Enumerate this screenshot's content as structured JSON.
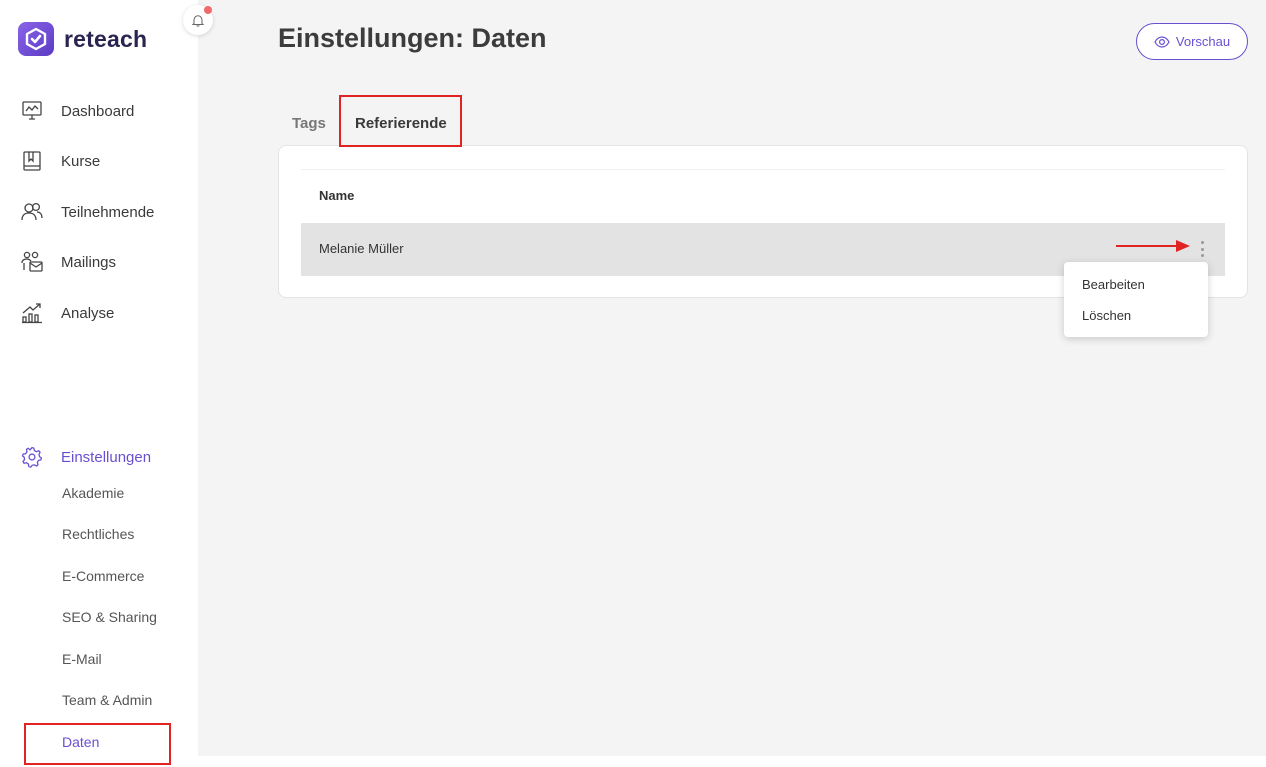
{
  "app": {
    "name": "reteach"
  },
  "sidebar": {
    "nav": [
      {
        "label": "Dashboard",
        "icon": "dashboard-monitor-icon"
      },
      {
        "label": "Kurse",
        "icon": "book-icon"
      },
      {
        "label": "Teilnehmende",
        "icon": "users-icon"
      },
      {
        "label": "Mailings",
        "icon": "mailing-users-icon"
      },
      {
        "label": "Analyse",
        "icon": "analytics-chart-icon"
      }
    ],
    "settings": {
      "label": "Einstellungen",
      "icon": "gear-icon",
      "items": [
        {
          "label": "Akademie"
        },
        {
          "label": "Rechtliches"
        },
        {
          "label": "E-Commerce"
        },
        {
          "label": "SEO & Sharing"
        },
        {
          "label": "E-Mail"
        },
        {
          "label": "Team & Admin"
        },
        {
          "label": "Daten",
          "active": true
        }
      ]
    }
  },
  "header": {
    "title": "Einstellungen: Daten",
    "preview_label": "Vorschau"
  },
  "tabs": [
    {
      "label": "Tags",
      "active": false
    },
    {
      "label": "Referierende",
      "active": true
    }
  ],
  "table": {
    "columns": [
      "Name"
    ],
    "rows": [
      {
        "name": "Melanie Müller"
      }
    ]
  },
  "context_menu": {
    "items": [
      "Bearbeiten",
      "Löschen"
    ]
  },
  "colors": {
    "accent": "#6a4fd1",
    "annotation": "#e02424",
    "notification_dot": "#ef6b6b",
    "main_background": "#f4f4f4",
    "row_selected": "#e3e3e3"
  }
}
